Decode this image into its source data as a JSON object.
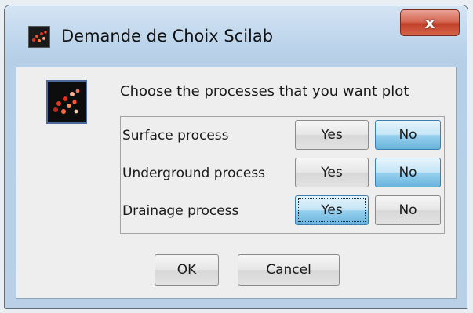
{
  "window": {
    "title": "Demande de Choix Scilab",
    "close_label": "x"
  },
  "dialog": {
    "prompt": "Choose the processes that you want plot",
    "rows": [
      {
        "label": "Surface process",
        "yes": "Yes",
        "no": "No",
        "selected": "No"
      },
      {
        "label": "Underground process",
        "yes": "Yes",
        "no": "No",
        "selected": "No"
      },
      {
        "label": "Drainage process",
        "yes": "Yes",
        "no": "No",
        "selected": "Yes"
      }
    ],
    "ok_label": "OK",
    "cancel_label": "Cancel"
  },
  "colors": {
    "selected_button": "#98d1ef",
    "close_button": "#c2402a"
  },
  "icons": {
    "app": "scilab-icon",
    "dialog": "scilab-logo-icon"
  }
}
